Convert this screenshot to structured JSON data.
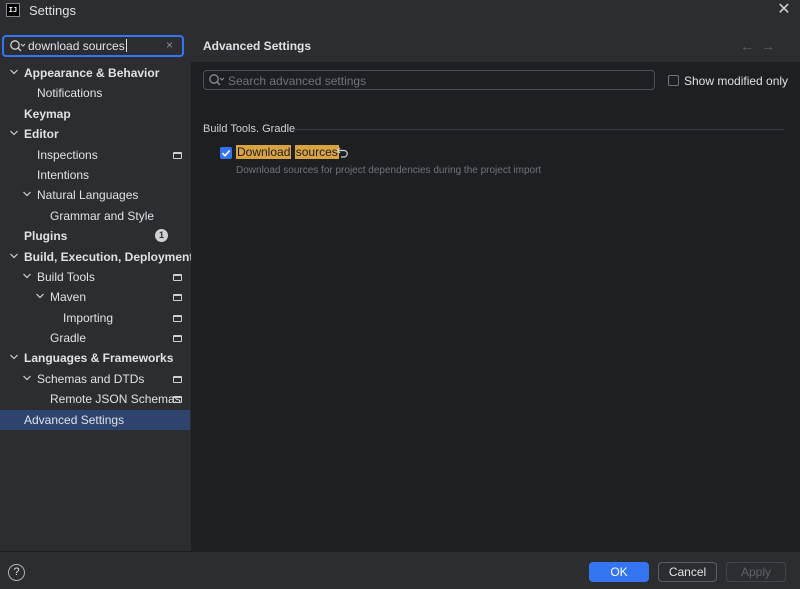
{
  "window": {
    "logo_text": "IJ",
    "title": "Settings",
    "close_glyph": "✕"
  },
  "sidebar": {
    "search_value": "download sources",
    "clear_glyph": "×",
    "tree": [
      {
        "label": "Appearance & Behavior",
        "bold": true,
        "level": 0,
        "expander": "expanded"
      },
      {
        "label": "Notifications",
        "bold": false,
        "level": 1,
        "expander": "none"
      },
      {
        "label": "Keymap",
        "bold": true,
        "level": 0,
        "expander": "none"
      },
      {
        "label": "Editor",
        "bold": true,
        "level": 0,
        "expander": "expanded"
      },
      {
        "label": "Inspections",
        "bold": false,
        "level": 1,
        "expander": "none",
        "project_icon": true
      },
      {
        "label": "Intentions",
        "bold": false,
        "level": 1,
        "expander": "none"
      },
      {
        "label": "Natural Languages",
        "bold": false,
        "level": 1,
        "expander": "expanded"
      },
      {
        "label": "Grammar and Style",
        "bold": false,
        "level": 2,
        "expander": "none"
      },
      {
        "label": "Plugins",
        "bold": true,
        "level": 0,
        "expander": "none",
        "badge": "1"
      },
      {
        "label": "Build, Execution, Deployment",
        "bold": true,
        "level": 0,
        "expander": "expanded"
      },
      {
        "label": "Build Tools",
        "bold": false,
        "level": 1,
        "expander": "expanded",
        "project_icon": true
      },
      {
        "label": "Maven",
        "bold": false,
        "level": 2,
        "expander": "expanded",
        "project_icon": true
      },
      {
        "label": "Importing",
        "bold": false,
        "level": 3,
        "expander": "none",
        "project_icon": true
      },
      {
        "label": "Gradle",
        "bold": false,
        "level": 2,
        "expander": "none",
        "project_icon": true
      },
      {
        "label": "Languages & Frameworks",
        "bold": true,
        "level": 0,
        "expander": "expanded"
      },
      {
        "label": "Schemas and DTDs",
        "bold": false,
        "level": 1,
        "expander": "expanded",
        "project_icon": true
      },
      {
        "label": "Remote JSON Schemas",
        "bold": false,
        "level": 2,
        "expander": "none",
        "project_icon": true
      },
      {
        "label": "Advanced Settings",
        "bold": false,
        "level": 0,
        "expander": "none",
        "selected": true
      }
    ]
  },
  "main": {
    "title": "Advanced Settings",
    "back_glyph": "←",
    "forward_glyph": "→",
    "search_placeholder": "Search advanced settings",
    "show_modified_label": "Show modified only",
    "show_modified_checked": false,
    "group_title": "Build Tools. Gradle",
    "option": {
      "label_part1": "Download",
      "label_part2": "sources",
      "checked": true,
      "description": "Download sources for project dependencies during the project import"
    }
  },
  "footer": {
    "help_glyph": "?",
    "ok_label": "OK",
    "cancel_label": "Cancel",
    "apply_label": "Apply"
  },
  "colors": {
    "accent": "#3574f0",
    "selection": "#2e436e",
    "highlight": "#d9a343",
    "background": "#2b2d30",
    "content_background": "#1e1f22"
  }
}
